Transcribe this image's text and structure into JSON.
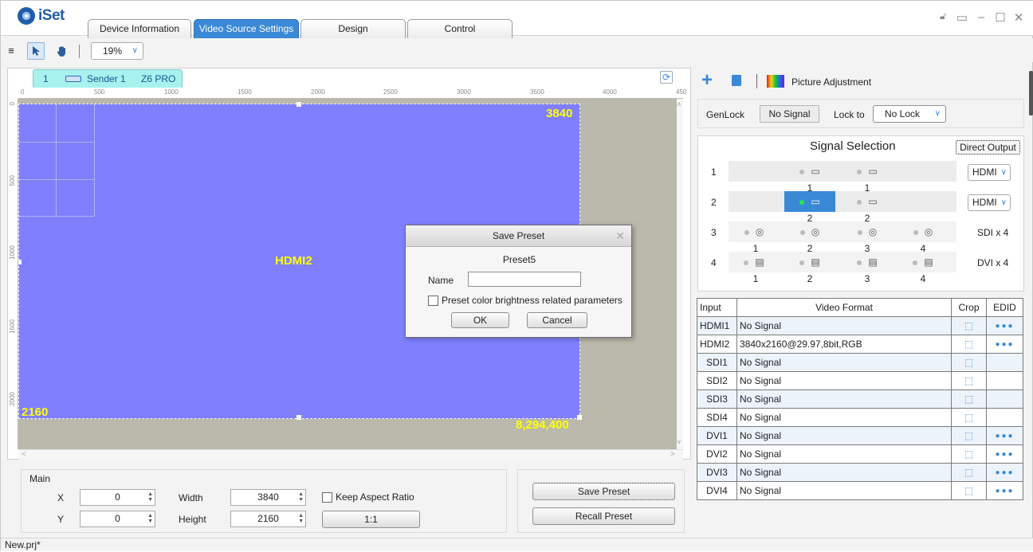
{
  "app": {
    "name": "iSet"
  },
  "tabs": [
    {
      "label": "Device Information"
    },
    {
      "label": "Video Source Settings"
    },
    {
      "label": "Design"
    },
    {
      "label": "Control"
    }
  ],
  "toolbar": {
    "menu_glyph": "≡",
    "zoom": "19%"
  },
  "sender": {
    "index": "1",
    "name": "Sender 1",
    "model": "Z6 PRO"
  },
  "ruler": {
    "top_ticks": [
      "0",
      "500",
      "1000",
      "1500",
      "2000",
      "2500",
      "3000",
      "3500",
      "4000",
      "450"
    ],
    "left_ticks": [
      "0",
      "500",
      "1000",
      "1500",
      "2000"
    ]
  },
  "layer": {
    "source": "HDMI2",
    "width": "3840",
    "height": "2160",
    "pixels": "8,294,400"
  },
  "main_panel": {
    "title": "Main",
    "x_label": "X",
    "x_value": "0",
    "y_label": "Y",
    "y_value": "0",
    "width_label": "Width",
    "width_value": "3840",
    "height_label": "Height",
    "height_value": "2160",
    "keep_aspect": "Keep Aspect Ratio",
    "ratio_button": "1:1"
  },
  "preset_panel": {
    "save": "Save Preset",
    "recall": "Recall Preset"
  },
  "right_top": {
    "picture_adjustment": "Picture Adjustment"
  },
  "genlock": {
    "label": "GenLock",
    "status": "No Signal",
    "lock_to_label": "Lock to",
    "lock_value": "No Lock"
  },
  "signal_selection": {
    "title": "Signal Selection",
    "direct_output": "Direct Output",
    "rows": [
      {
        "num": "1",
        "ports": [
          "1",
          "1"
        ],
        "type": "HDMI"
      },
      {
        "num": "2",
        "ports": [
          "2",
          "2"
        ],
        "type": "HDMI"
      },
      {
        "num": "3",
        "ports": [
          "1",
          "2",
          "3",
          "4"
        ],
        "type": "SDI x 4"
      },
      {
        "num": "4",
        "ports": [
          "1",
          "2",
          "3",
          "4"
        ],
        "type": "DVI x 4"
      }
    ]
  },
  "input_table": {
    "headers": [
      "Input",
      "Video Format",
      "Crop",
      "EDID"
    ],
    "rows": [
      {
        "input": "HDMI1",
        "format": "No Signal",
        "edid": true
      },
      {
        "input": "HDMI2",
        "format": "3840x2160@29.97,8bit,RGB",
        "edid": true
      },
      {
        "input": "SDI1",
        "format": "No Signal",
        "edid": false
      },
      {
        "input": "SDI2",
        "format": "No Signal",
        "edid": false
      },
      {
        "input": "SDI3",
        "format": "No Signal",
        "edid": false
      },
      {
        "input": "SDI4",
        "format": "No Signal",
        "edid": false
      },
      {
        "input": "DVI1",
        "format": "No Signal",
        "edid": true
      },
      {
        "input": "DVI2",
        "format": "No Signal",
        "edid": true
      },
      {
        "input": "DVI3",
        "format": "No Signal",
        "edid": true
      },
      {
        "input": "DVI4",
        "format": "No Signal",
        "edid": true
      }
    ]
  },
  "dialog": {
    "title": "Save Preset",
    "preset_name": "Preset5",
    "name_label": "Name",
    "name_value": "",
    "checkbox_label": "Preset color brightness related parameters",
    "ok": "OK",
    "cancel": "Cancel"
  },
  "status_bar": {
    "file": "New.prj*"
  },
  "colors": {
    "accent": "#3a89d6",
    "layer": "#8080ff",
    "layer_text": "#ffff00",
    "stage": "#bab9ab"
  }
}
